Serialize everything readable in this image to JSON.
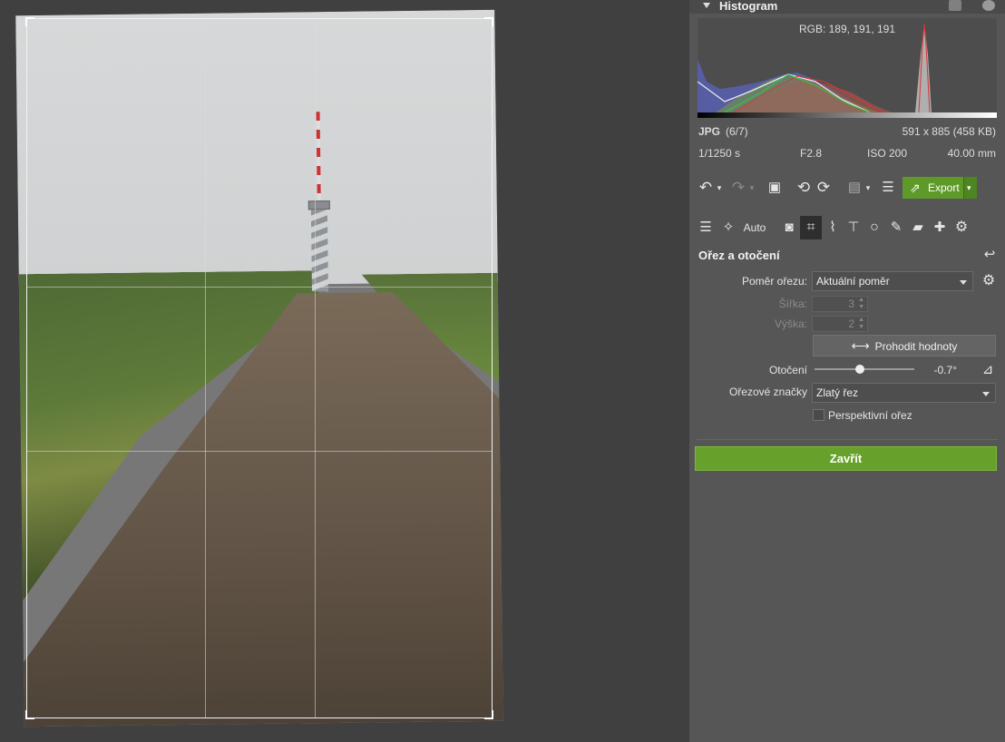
{
  "histogram": {
    "title": "Histogram",
    "rgb_readout": "RGB: 189, 191, 191"
  },
  "file_info": {
    "format": "JPG",
    "index": "(6/7)",
    "dimensions": "591 x 885 (458 KB)",
    "shutter": "1/1250 s",
    "aperture": "F2.8",
    "iso": "ISO 200",
    "focal": "40.00 mm"
  },
  "toolbar": {
    "export_label": "Export",
    "auto_label": "Auto"
  },
  "crop": {
    "section_title": "Ořez a otočení",
    "ratio_label": "Poměr ořezu:",
    "ratio_value": "Aktuální poměr",
    "width_label": "Šířka:",
    "width_value": "3",
    "height_label": "Výška:",
    "height_value": "2",
    "swap_label": "Prohodit hodnoty",
    "rotation_label": "Otočení",
    "rotation_value": "-0.7°",
    "rotation_fraction": 0.45,
    "marks_label": "Ořezové značky",
    "marks_value": "Zlatý řez",
    "perspective_label": "Perspektivní ořez",
    "perspective_checked": false,
    "close_label": "Zavřít"
  },
  "colors": {
    "accent_green": "#67a02a",
    "panel_bg": "#565656",
    "canvas_bg": "#404040"
  }
}
